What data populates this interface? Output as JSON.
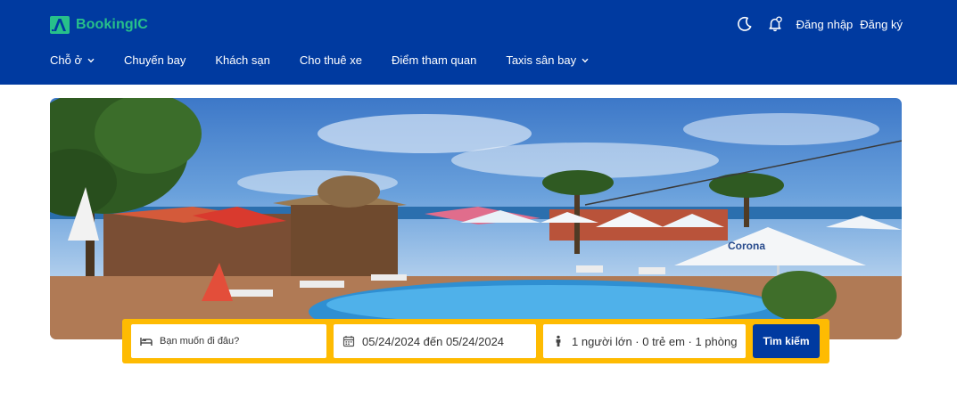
{
  "brand": {
    "name": "BookingIC",
    "logo_icon": "a-logo-icon",
    "color": "#27c08a"
  },
  "header": {
    "background": "#003aa0",
    "icons": [
      "moon-icon",
      "bell-icon"
    ],
    "login_label": "Đăng nhập",
    "register_label": "Đăng ký"
  },
  "nav": {
    "items": [
      {
        "label": "Chỗ ở",
        "has_dropdown": true
      },
      {
        "label": "Chuyến bay",
        "has_dropdown": false
      },
      {
        "label": "Khách sạn",
        "has_dropdown": false
      },
      {
        "label": "Cho thuê xe",
        "has_dropdown": false
      },
      {
        "label": "Điểm tham quan",
        "has_dropdown": false
      },
      {
        "label": "Taxis sân bay",
        "has_dropdown": true
      }
    ]
  },
  "hero": {
    "image": "beach-resort-pool-photo"
  },
  "search": {
    "bar_color": "#febb02",
    "destination_placeholder": "Bạn muốn đi đâu?",
    "destination_value": "",
    "dates_value": "05/24/2024 đến 05/24/2024",
    "guests_value": "1 người lớn · 0 trẻ em · 1 phòng",
    "submit_label": "Tìm kiếm"
  }
}
